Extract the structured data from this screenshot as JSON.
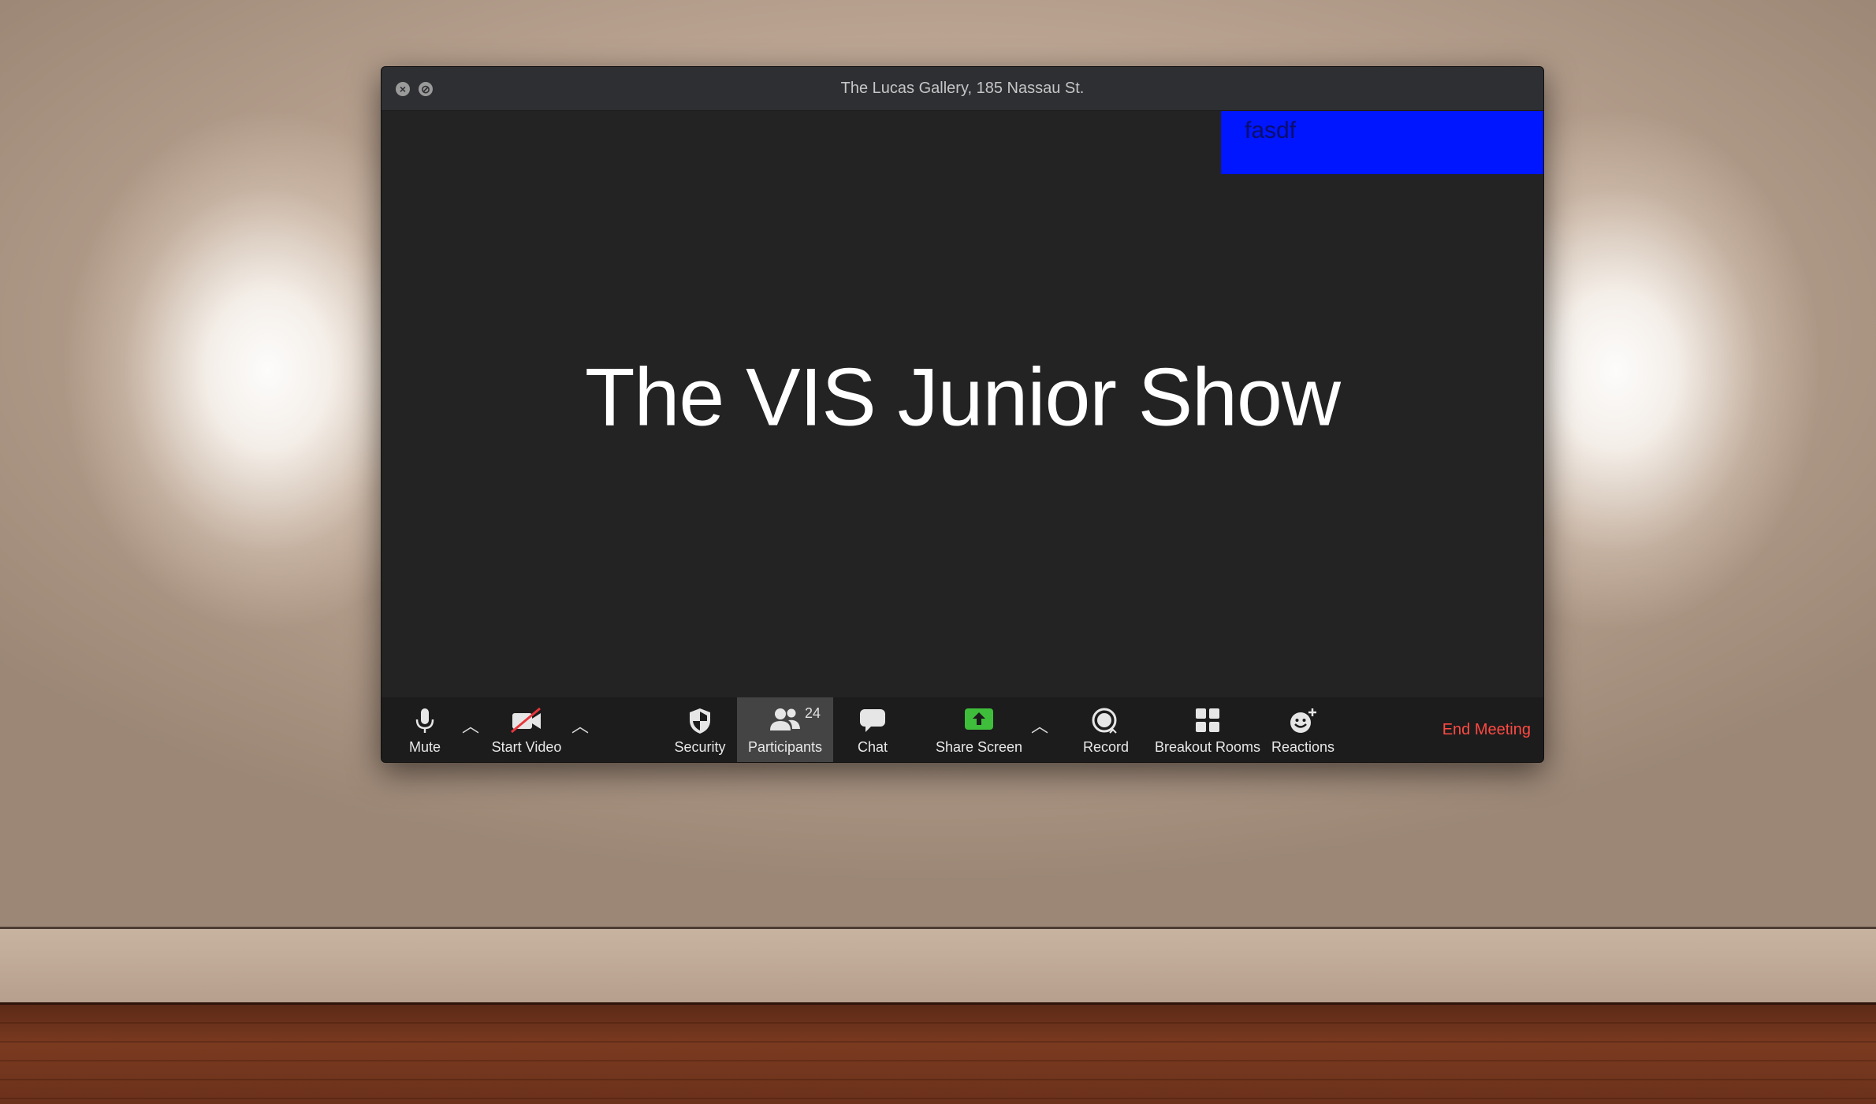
{
  "window": {
    "title": "The Lucas Gallery, 185 Nassau St.",
    "controls": {
      "close_icon": "close-icon",
      "minimize_icon": "no-entry-icon"
    }
  },
  "stage": {
    "slide_title": "The VIS Junior Show",
    "overlay_text": "fasdf"
  },
  "toolbar": {
    "mute": {
      "label": "Mute",
      "icon": "microphone-icon"
    },
    "start_video": {
      "label": "Start Video",
      "icon": "video-off-icon"
    },
    "security": {
      "label": "Security",
      "icon": "shield-icon"
    },
    "participants": {
      "label": "Participants",
      "count": "24",
      "icon": "participants-icon"
    },
    "chat": {
      "label": "Chat",
      "icon": "chat-bubble-icon"
    },
    "share_screen": {
      "label": "Share Screen",
      "icon": "share-arrow-icon"
    },
    "record": {
      "label": "Record",
      "icon": "record-icon"
    },
    "breakout_rooms": {
      "label": "Breakout Rooms",
      "icon": "grid-icon"
    },
    "reactions": {
      "label": "Reactions",
      "icon": "smiley-add-icon"
    },
    "end_meeting": "End Meeting"
  },
  "colors": {
    "end_meeting": "#ff4a43",
    "share_screen": "#3fbe3c",
    "overlay": "#0016ff",
    "toolbar_bg": "#1c1c1c"
  }
}
